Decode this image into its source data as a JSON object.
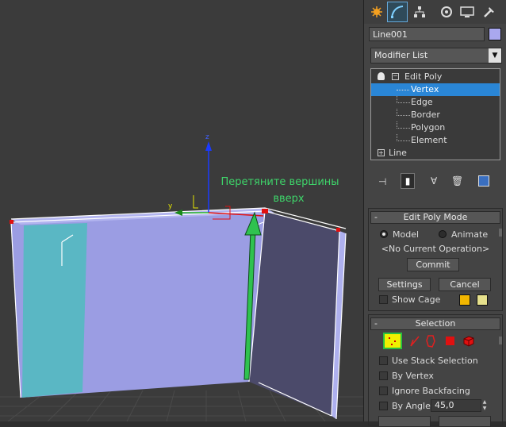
{
  "viewport": {
    "annotation_line1": "Перетяните вершины",
    "annotation_line2": "вверх",
    "axis_z": "z",
    "axis_y": "y"
  },
  "panel": {
    "tabs": [
      "create-icon",
      "modify-icon",
      "hierarchy-icon",
      "motion-icon",
      "display-icon",
      "utilities-icon"
    ],
    "object_name": "Line001",
    "object_color": "#a9a8ef",
    "modifier_list": "Modifier List",
    "stack": {
      "edit_poly": "Edit Poly",
      "items": [
        "Vertex",
        "Edge",
        "Border",
        "Polygon",
        "Element"
      ],
      "selected": "Vertex",
      "line": "Line"
    },
    "edit_poly_mode": {
      "title": "Edit Poly Mode",
      "model": "Model",
      "animate": "Animate",
      "operation": "<No Current Operation>",
      "commit": "Commit",
      "settings": "Settings",
      "cancel": "Cancel",
      "show_cage": "Show Cage",
      "cage_color_1": "#f2b600",
      "cage_color_2": "#e6e08c"
    },
    "selection": {
      "title": "Selection",
      "use_stack_selection": "Use Stack Selection",
      "by_vertex": "By Vertex",
      "ignore_backfacing": "Ignore Backfacing",
      "by_angle": "By Angle:",
      "by_angle_value": "45,0"
    }
  }
}
